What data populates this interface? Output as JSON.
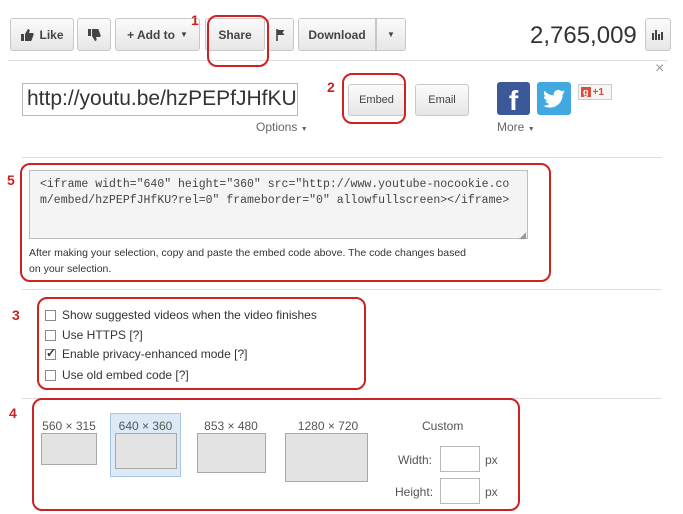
{
  "toolbar": {
    "like_label": "Like",
    "add_to_label": "+ Add to",
    "share_label": "Share",
    "download_label": "Download",
    "view_count": "2,765,009"
  },
  "share_panel": {
    "url": "http://youtu.be/hzPEPfJHfKU",
    "options_label": "Options",
    "embed_label": "Embed",
    "email_label": "Email",
    "gplus_label": "+1",
    "more_label": "More",
    "close_glyph": "×"
  },
  "embed": {
    "code": "<iframe width=\"640\" height=\"360\" src=\"http://www.youtube-nocookie.com/embed/hzPEPfJHfKU?rel=0\" frameborder=\"0\" allowfullscreen></iframe>",
    "help_line1": "After making your selection, copy and paste the embed code above. The code changes based",
    "help_line2": "on your selection."
  },
  "options": [
    {
      "label": "Show suggested videos when the video finishes",
      "checked": false
    },
    {
      "label": "Use HTTPS [?]",
      "checked": false
    },
    {
      "label": "Enable privacy-enhanced mode [?]",
      "checked": true
    },
    {
      "label": "Use old embed code [?]",
      "checked": false
    }
  ],
  "sizes": {
    "items": [
      "560 × 315",
      "640 × 360",
      "853 × 480",
      "1280 × 720"
    ],
    "selected_index": 1,
    "custom_label": "Custom",
    "width_label": "Width:",
    "height_label": "Height:",
    "unit": "px"
  },
  "annotations": [
    "1",
    "2",
    "3",
    "4",
    "5"
  ],
  "colors": {
    "annotation_red": "#cc2222",
    "facebook": "#3b5998",
    "twitter": "#41a9e0",
    "gplus": "#dd4b39"
  }
}
